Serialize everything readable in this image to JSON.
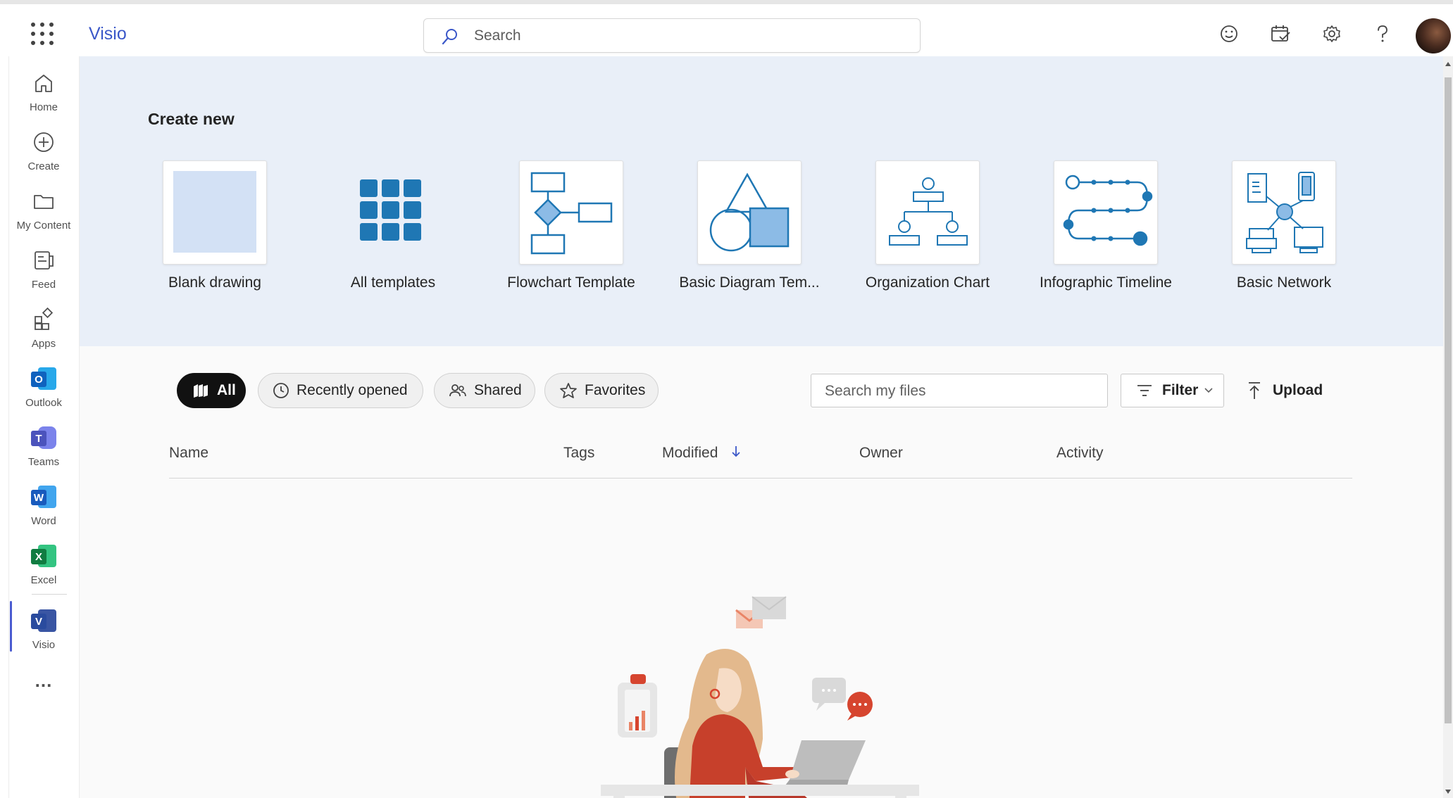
{
  "app": {
    "title": "Visio"
  },
  "search": {
    "placeholder": "Search"
  },
  "header_icons": [
    "smiley-icon",
    "calendar-check-icon",
    "gear-icon",
    "help-icon"
  ],
  "rail": {
    "items": [
      {
        "label": "Home",
        "icon": "home-icon"
      },
      {
        "label": "Create",
        "icon": "plus-circle-icon"
      },
      {
        "label": "My Content",
        "icon": "folder-icon"
      },
      {
        "label": "Feed",
        "icon": "feed-icon"
      },
      {
        "label": "Apps",
        "icon": "apps-icon"
      },
      {
        "label": "Outlook",
        "icon": "outlook-icon"
      },
      {
        "label": "Teams",
        "icon": "teams-icon"
      },
      {
        "label": "Word",
        "icon": "word-icon"
      },
      {
        "label": "Excel",
        "icon": "excel-icon"
      },
      {
        "label": "Visio",
        "icon": "visio-icon"
      }
    ],
    "more": "..."
  },
  "create_new": {
    "title": "Create new",
    "templates": [
      {
        "label": "Blank drawing"
      },
      {
        "label": "All templates"
      },
      {
        "label": "Flowchart Template"
      },
      {
        "label": "Basic Diagram Tem..."
      },
      {
        "label": "Organization Chart"
      },
      {
        "label": "Infographic Timeline"
      },
      {
        "label": "Basic Network"
      }
    ]
  },
  "files": {
    "filters": [
      {
        "label": "All",
        "active": true
      },
      {
        "label": "Recently opened",
        "active": false
      },
      {
        "label": "Shared",
        "active": false
      },
      {
        "label": "Favorites",
        "active": false
      }
    ],
    "search_placeholder": "Search my files",
    "filter_label": "Filter",
    "upload_label": "Upload",
    "columns": [
      "Name",
      "Tags",
      "Modified",
      "Owner",
      "Activity"
    ],
    "sort_column": "Modified",
    "sort_direction": "descending"
  },
  "colors": {
    "accent": "#3a57c8",
    "template_blue": "#1f77b4",
    "hero_bg": "#e9eff8"
  }
}
